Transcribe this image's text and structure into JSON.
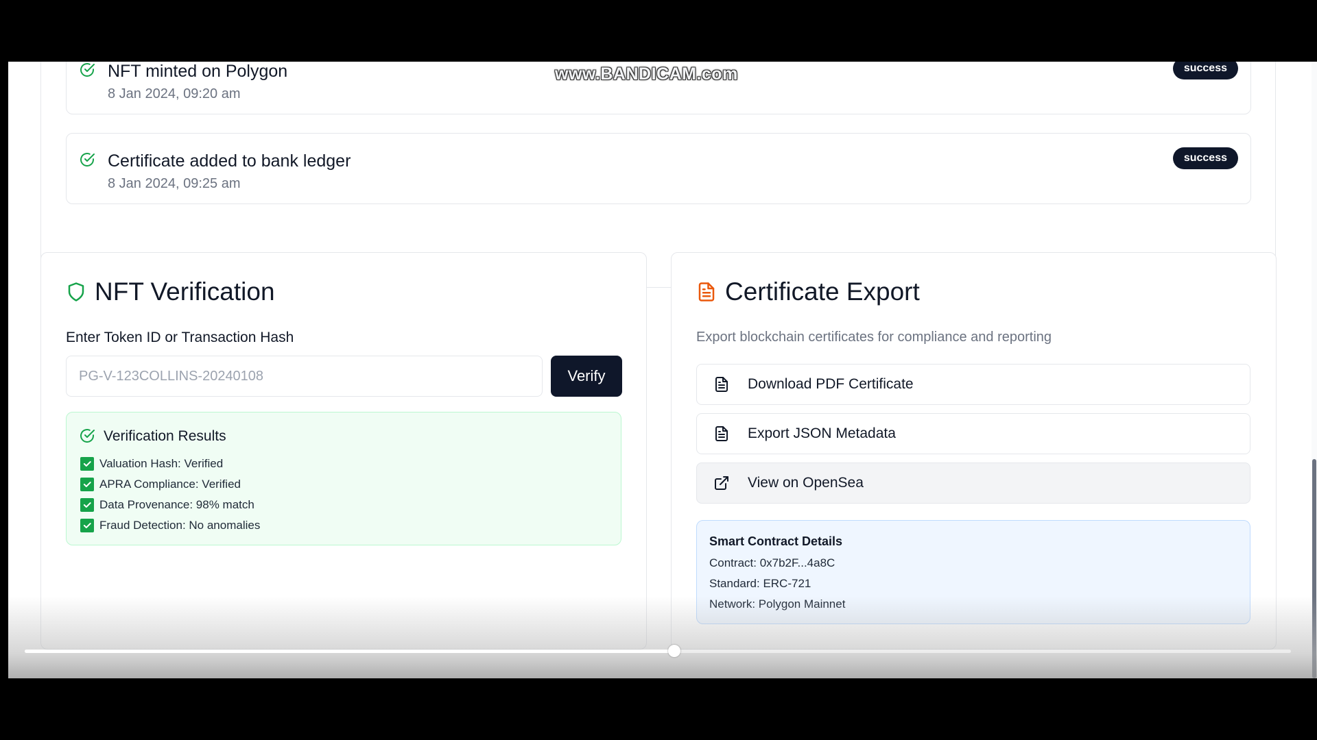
{
  "watermark": "www.BANDICAM.com",
  "timeline": {
    "items": [
      {
        "title": "NFT minted on Polygon",
        "date": "8 Jan 2024, 09:20 am",
        "status": "success"
      },
      {
        "title": "Certificate added to bank ledger",
        "date": "8 Jan 2024, 09:25 am",
        "status": "success"
      }
    ]
  },
  "verification": {
    "title": "NFT Verification",
    "label": "Enter Token ID or Transaction Hash",
    "placeholder": "PG-V-123COLLINS-20240108",
    "button": "Verify",
    "results_title": "Verification Results",
    "results": [
      "Valuation Hash: Verified",
      "APRA Compliance: Verified",
      "Data Provenance: 98% match",
      "Fraud Detection: No anomalies"
    ]
  },
  "export": {
    "title": "Certificate Export",
    "description": "Export blockchain certificates for compliance and reporting",
    "buttons": {
      "pdf": "Download PDF Certificate",
      "json": "Export JSON Metadata",
      "opensea": "View on OpenSea"
    },
    "contract": {
      "title": "Smart Contract Details",
      "contract": "Contract: 0x7b2F...4a8C",
      "standard": "Standard: ERC-721",
      "network": "Network: Polygon Mainnet"
    }
  },
  "video": {
    "progress": 0.513
  },
  "colors": {
    "success_green": "#16a34a",
    "accent_orange": "#ea580c",
    "dark_navy": "#0f172a"
  }
}
